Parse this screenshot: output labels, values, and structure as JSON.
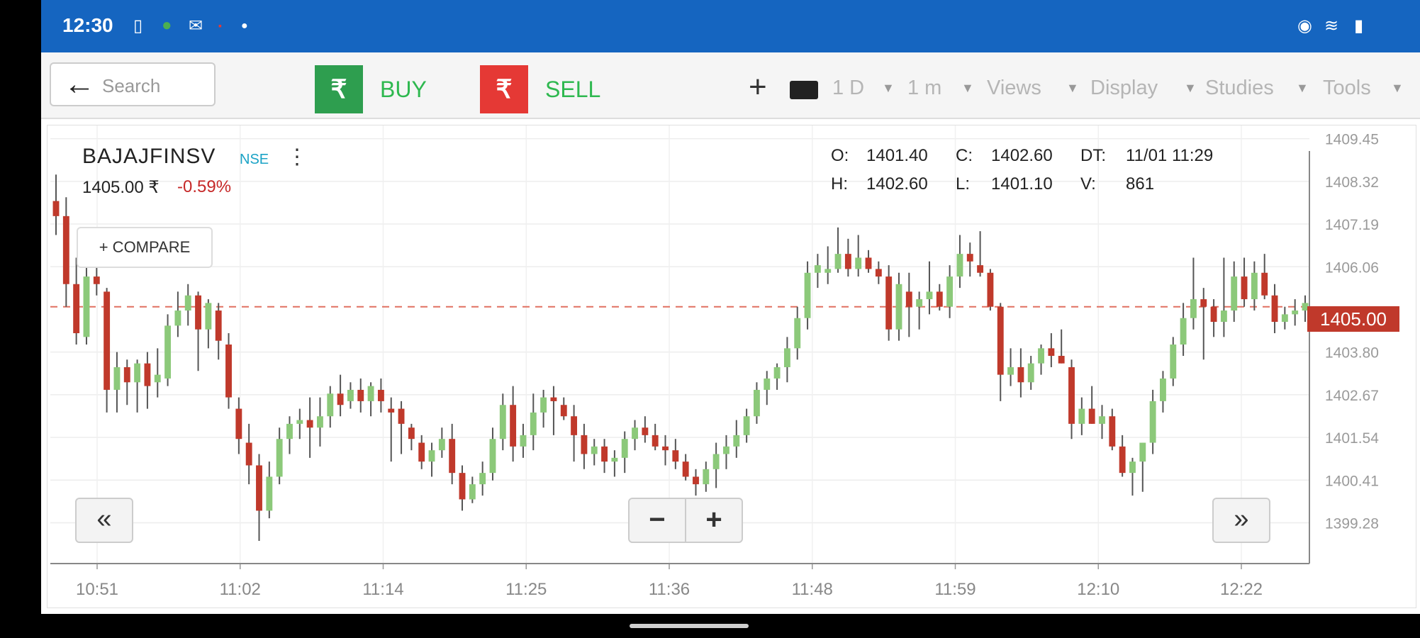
{
  "status_bar": {
    "time": "12:30",
    "left_icons": [
      "sim-icon",
      "whatsapp-icon",
      "mail-icon",
      "notification-icon",
      "dot-icon"
    ],
    "right_icons": [
      "data-saver-icon",
      "wifi-icon",
      "battery-icon"
    ]
  },
  "toolbar": {
    "search_placeholder": "Search",
    "buy_symbol": "₹",
    "buy_label": "BUY",
    "sell_symbol": "₹",
    "sell_label": "SELL",
    "period": "1 D",
    "interval": "1 m",
    "views": "Views",
    "display": "Display",
    "studies": "Studies",
    "tools": "Tools"
  },
  "chart_header": {
    "symbol": "BAJAJFINSV",
    "exchange": "NSE",
    "price": "1405.00 ₹",
    "change": "-0.59%",
    "compare": "+ COMPARE"
  },
  "ohlc": {
    "o_label": "O:",
    "o": "1401.40",
    "c_label": "C:",
    "c": "1402.60",
    "dt_label": "DT:",
    "dt": "11/01 11:29",
    "h_label": "H:",
    "h": "1402.60",
    "l_label": "L:",
    "l": "1401.10",
    "v_label": "V:",
    "v": "861"
  },
  "controls": {
    "prev": "«",
    "next": "»",
    "zoom_out": "−",
    "zoom_in": "+"
  },
  "current_price_tag": "1405.00",
  "colors": {
    "up": "#8cc97a",
    "down": "#c0392b",
    "accent": "#1565c0",
    "price_line": "#e07060"
  },
  "chart_data": {
    "type": "candlestick",
    "x_ticks": [
      "10:51",
      "11:02",
      "11:14",
      "11:25",
      "11:36",
      "11:48",
      "11:59",
      "12:10",
      "12:22"
    ],
    "y_ticks": [
      "1409.45",
      "1408.32",
      "1407.19",
      "1406.06",
      "1403.80",
      "1402.67",
      "1401.54",
      "1400.41",
      "1399.28"
    ],
    "ylim": [
      1398.2,
      1409.8
    ],
    "reference_line": 1405.0,
    "candles": [
      [
        1407.8,
        1408.5,
        1406.9,
        1407.4
      ],
      [
        1407.4,
        1407.9,
        1405.0,
        1405.6
      ],
      [
        1405.6,
        1406.3,
        1404.0,
        1404.3
      ],
      [
        1404.2,
        1406.1,
        1404.0,
        1405.8
      ],
      [
        1405.8,
        1406.4,
        1405.3,
        1405.6
      ],
      [
        1405.4,
        1405.5,
        1402.2,
        1402.8
      ],
      [
        1402.8,
        1403.8,
        1402.2,
        1403.4
      ],
      [
        1403.4,
        1403.6,
        1402.4,
        1403.0
      ],
      [
        1403.0,
        1403.6,
        1402.2,
        1403.5
      ],
      [
        1403.5,
        1403.8,
        1402.3,
        1402.9
      ],
      [
        1403.0,
        1403.9,
        1402.6,
        1403.2
      ],
      [
        1403.1,
        1404.8,
        1402.9,
        1404.5
      ],
      [
        1404.5,
        1405.4,
        1404.2,
        1404.9
      ],
      [
        1404.9,
        1405.6,
        1404.5,
        1405.3
      ],
      [
        1405.3,
        1405.4,
        1403.3,
        1404.4
      ],
      [
        1404.4,
        1405.2,
        1403.9,
        1405.1
      ],
      [
        1404.9,
        1405.1,
        1403.6,
        1404.1
      ],
      [
        1404.0,
        1404.3,
        1402.3,
        1402.6
      ],
      [
        1402.3,
        1402.6,
        1401.1,
        1401.5
      ],
      [
        1401.4,
        1401.9,
        1400.3,
        1400.8
      ],
      [
        1400.8,
        1401.1,
        1398.8,
        1399.6
      ],
      [
        1399.6,
        1400.9,
        1399.4,
        1400.5
      ],
      [
        1400.5,
        1401.8,
        1400.3,
        1401.5
      ],
      [
        1401.5,
        1402.1,
        1401.1,
        1401.9
      ],
      [
        1401.9,
        1402.3,
        1401.5,
        1402.0
      ],
      [
        1402.0,
        1402.6,
        1401.0,
        1401.8
      ],
      [
        1401.8,
        1402.6,
        1401.3,
        1402.1
      ],
      [
        1402.1,
        1402.9,
        1401.8,
        1402.7
      ],
      [
        1402.7,
        1403.2,
        1402.1,
        1402.4
      ],
      [
        1402.5,
        1403.0,
        1402.3,
        1402.8
      ],
      [
        1402.8,
        1403.1,
        1402.2,
        1402.5
      ],
      [
        1402.5,
        1403.0,
        1402.1,
        1402.9
      ],
      [
        1402.8,
        1403.1,
        1402.2,
        1402.5
      ],
      [
        1402.3,
        1402.6,
        1400.9,
        1402.2
      ],
      [
        1402.3,
        1402.5,
        1401.1,
        1401.9
      ],
      [
        1401.8,
        1401.9,
        1401.2,
        1401.5
      ],
      [
        1401.4,
        1401.6,
        1400.7,
        1400.9
      ],
      [
        1400.9,
        1401.4,
        1400.5,
        1401.2
      ],
      [
        1401.2,
        1401.8,
        1401.0,
        1401.5
      ],
      [
        1401.5,
        1401.9,
        1400.3,
        1400.6
      ],
      [
        1400.6,
        1400.8,
        1399.6,
        1399.9
      ],
      [
        1399.9,
        1400.5,
        1399.8,
        1400.3
      ],
      [
        1400.3,
        1400.9,
        1400.0,
        1400.6
      ],
      [
        1400.6,
        1401.8,
        1400.4,
        1401.5
      ],
      [
        1401.5,
        1402.7,
        1401.2,
        1402.4
      ],
      [
        1402.4,
        1402.9,
        1400.9,
        1401.3
      ],
      [
        1401.3,
        1401.9,
        1401.0,
        1401.6
      ],
      [
        1401.6,
        1402.7,
        1401.2,
        1402.2
      ],
      [
        1402.2,
        1402.8,
        1401.8,
        1402.6
      ],
      [
        1402.6,
        1402.9,
        1401.6,
        1402.5
      ],
      [
        1402.4,
        1402.6,
        1402.0,
        1402.1
      ],
      [
        1402.1,
        1402.4,
        1400.9,
        1401.6
      ],
      [
        1401.6,
        1401.9,
        1400.7,
        1401.1
      ],
      [
        1401.1,
        1401.5,
        1400.8,
        1401.3
      ],
      [
        1401.3,
        1401.5,
        1400.6,
        1400.9
      ],
      [
        1400.9,
        1401.2,
        1400.5,
        1401.0
      ],
      [
        1401.0,
        1401.7,
        1400.6,
        1401.5
      ],
      [
        1401.5,
        1402.0,
        1401.2,
        1401.8
      ],
      [
        1401.8,
        1402.1,
        1401.4,
        1401.6
      ],
      [
        1401.6,
        1401.9,
        1401.2,
        1401.3
      ],
      [
        1401.3,
        1401.6,
        1400.8,
        1401.2
      ],
      [
        1401.2,
        1401.5,
        1400.7,
        1400.9
      ],
      [
        1400.9,
        1401.1,
        1400.4,
        1400.5
      ],
      [
        1400.5,
        1400.7,
        1400.0,
        1400.3
      ],
      [
        1400.3,
        1400.9,
        1400.1,
        1400.7
      ],
      [
        1400.7,
        1401.4,
        1400.2,
        1401.1
      ],
      [
        1401.1,
        1401.6,
        1400.7,
        1401.3
      ],
      [
        1401.3,
        1402.0,
        1401.0,
        1401.6
      ],
      [
        1401.6,
        1402.3,
        1401.4,
        1402.1
      ],
      [
        1402.1,
        1403.0,
        1401.9,
        1402.8
      ],
      [
        1402.8,
        1403.3,
        1402.4,
        1403.1
      ],
      [
        1403.1,
        1403.5,
        1402.8,
        1403.4
      ],
      [
        1403.4,
        1404.2,
        1403.0,
        1403.9
      ],
      [
        1403.9,
        1405.0,
        1403.6,
        1404.7
      ],
      [
        1404.7,
        1406.2,
        1404.4,
        1405.9
      ],
      [
        1405.9,
        1406.4,
        1405.5,
        1406.1
      ],
      [
        1405.9,
        1406.6,
        1405.6,
        1406.0
      ],
      [
        1406.0,
        1407.1,
        1405.9,
        1406.4
      ],
      [
        1406.4,
        1406.8,
        1405.8,
        1406.0
      ],
      [
        1406.0,
        1406.9,
        1405.8,
        1406.3
      ],
      [
        1406.3,
        1406.5,
        1405.9,
        1406.0
      ],
      [
        1406.0,
        1406.2,
        1405.6,
        1405.8
      ],
      [
        1405.8,
        1406.1,
        1404.1,
        1404.4
      ],
      [
        1404.4,
        1405.9,
        1404.1,
        1405.6
      ],
      [
        1405.4,
        1405.9,
        1404.2,
        1405.0
      ],
      [
        1405.0,
        1405.4,
        1404.4,
        1405.2
      ],
      [
        1405.2,
        1406.2,
        1404.8,
        1405.4
      ],
      [
        1405.4,
        1405.6,
        1404.9,
        1405.0
      ],
      [
        1405.0,
        1406.1,
        1404.7,
        1405.8
      ],
      [
        1405.8,
        1406.9,
        1405.5,
        1406.4
      ],
      [
        1406.4,
        1406.7,
        1405.8,
        1406.2
      ],
      [
        1406.1,
        1407.0,
        1405.8,
        1405.9
      ],
      [
        1405.9,
        1406.0,
        1404.9,
        1405.0
      ],
      [
        1405.0,
        1405.1,
        1402.5,
        1403.2
      ],
      [
        1403.2,
        1403.9,
        1402.9,
        1403.4
      ],
      [
        1403.4,
        1403.9,
        1402.6,
        1403.0
      ],
      [
        1403.0,
        1403.7,
        1402.8,
        1403.5
      ],
      [
        1403.5,
        1404.0,
        1403.2,
        1403.9
      ],
      [
        1403.9,
        1404.3,
        1403.4,
        1403.7
      ],
      [
        1403.7,
        1404.4,
        1403.5,
        1403.5
      ],
      [
        1403.4,
        1403.6,
        1401.5,
        1401.9
      ],
      [
        1401.9,
        1402.6,
        1401.6,
        1402.3
      ],
      [
        1402.3,
        1402.9,
        1401.9,
        1401.9
      ],
      [
        1401.9,
        1402.4,
        1401.5,
        1402.1
      ],
      [
        1402.1,
        1402.3,
        1401.2,
        1401.3
      ],
      [
        1401.3,
        1401.6,
        1400.5,
        1400.6
      ],
      [
        1400.6,
        1401.0,
        1400.0,
        1400.9
      ],
      [
        1400.9,
        1401.4,
        1400.1,
        1401.4
      ],
      [
        1401.4,
        1402.8,
        1401.1,
        1402.5
      ],
      [
        1402.5,
        1403.3,
        1402.2,
        1403.1
      ],
      [
        1403.1,
        1404.2,
        1402.9,
        1404.0
      ],
      [
        1404.0,
        1405.1,
        1403.7,
        1404.7
      ],
      [
        1404.7,
        1406.3,
        1404.4,
        1405.2
      ],
      [
        1405.2,
        1405.5,
        1403.6,
        1405.0
      ],
      [
        1405.0,
        1405.2,
        1404.2,
        1404.6
      ],
      [
        1404.6,
        1406.3,
        1404.2,
        1404.9
      ],
      [
        1404.9,
        1406.2,
        1404.6,
        1405.8
      ],
      [
        1405.8,
        1406.3,
        1405.0,
        1405.2
      ],
      [
        1405.2,
        1406.2,
        1404.9,
        1405.9
      ],
      [
        1405.9,
        1406.4,
        1405.2,
        1405.3
      ],
      [
        1405.3,
        1405.6,
        1404.3,
        1404.6
      ],
      [
        1404.6,
        1405.0,
        1404.4,
        1404.8
      ],
      [
        1404.8,
        1405.2,
        1404.5,
        1404.9
      ],
      [
        1404.9,
        1405.3,
        1404.6,
        1405.1
      ]
    ]
  }
}
